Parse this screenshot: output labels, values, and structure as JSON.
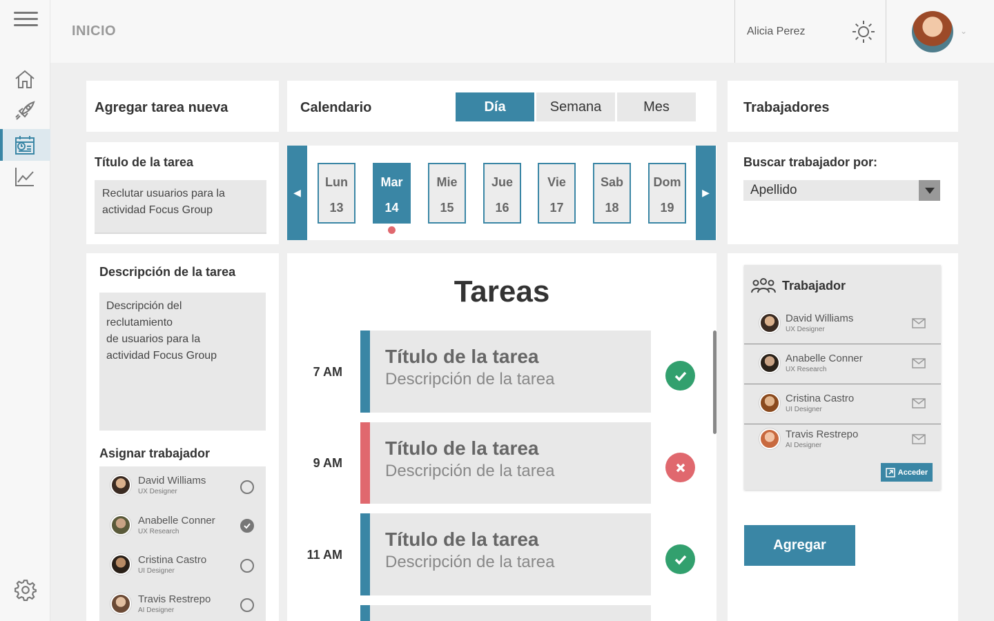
{
  "header": {
    "page_title": "INICIO",
    "user_name": "Alicia Perez"
  },
  "sidebar": {
    "items": [
      {
        "name": "home",
        "icon": "home-icon"
      },
      {
        "name": "launch",
        "icon": "rocket-icon"
      },
      {
        "name": "calendar",
        "icon": "calendar-icon",
        "active": true
      },
      {
        "name": "stats",
        "icon": "chart-icon"
      }
    ],
    "settings_icon": "gear-icon"
  },
  "new_task": {
    "header": "Agregar tarea nueva",
    "title_label": "Título de la tarea",
    "title_value": "Reclutar usuarios para la\nactividad Focus Group",
    "desc_label": "Descripción de la tarea",
    "desc_value": "Descripción del\nreclutamiento\nde usuarios para la\nactividad Focus Group",
    "assign_label": "Asignar trabajador",
    "assign_list": [
      {
        "name": "David Williams",
        "role": "UX Designer",
        "checked": false
      },
      {
        "name": "Anabelle Conner",
        "role": "UX Research",
        "checked": true
      },
      {
        "name": "Cristina Castro",
        "role": "UI Designer",
        "checked": false
      },
      {
        "name": "Travis Restrepo",
        "role": "AI Designer",
        "checked": false
      }
    ]
  },
  "calendar": {
    "title": "Calendario",
    "tabs": [
      "Día",
      "Semana",
      "Mes"
    ],
    "active_tab": "Día",
    "days": [
      {
        "name": "Lun",
        "num": "13"
      },
      {
        "name": "Mar",
        "num": "14"
      },
      {
        "name": "Mie",
        "num": "15"
      },
      {
        "name": "Jue",
        "num": "16"
      },
      {
        "name": "Vie",
        "num": "17"
      },
      {
        "name": "Sab",
        "num": "18"
      },
      {
        "name": "Dom",
        "num": "19"
      }
    ],
    "active_day": "14"
  },
  "tasks": {
    "title": "Tareas",
    "items": [
      {
        "time": "7 AM",
        "title": "Título de la tarea",
        "desc": "Descripción de la tarea",
        "status": "done"
      },
      {
        "time": "9 AM",
        "title": "Título de la tarea",
        "desc": "Descripción de la tarea",
        "status": "cancelled"
      },
      {
        "time": "11 AM",
        "title": "Título de la tarea",
        "desc": "Descripción de la tarea",
        "status": "done"
      }
    ]
  },
  "workers": {
    "header": "Trabajadores",
    "search_label": "Buscar trabajador por:",
    "search_value": "Apellido",
    "panel_title": "Trabajador",
    "list": [
      {
        "name": "David Williams",
        "role": "UX Designer"
      },
      {
        "name": "Anabelle Conner",
        "role": "UX Research"
      },
      {
        "name": "Cristina Castro",
        "role": "UI Designer"
      },
      {
        "name": "Travis Restrepo",
        "role": "AI Designer"
      }
    ],
    "access_label": "Acceder",
    "add_label": "Agregar"
  },
  "colors": {
    "accent": "#3a86a5",
    "danger": "#e0686e",
    "success": "#32a06e"
  }
}
